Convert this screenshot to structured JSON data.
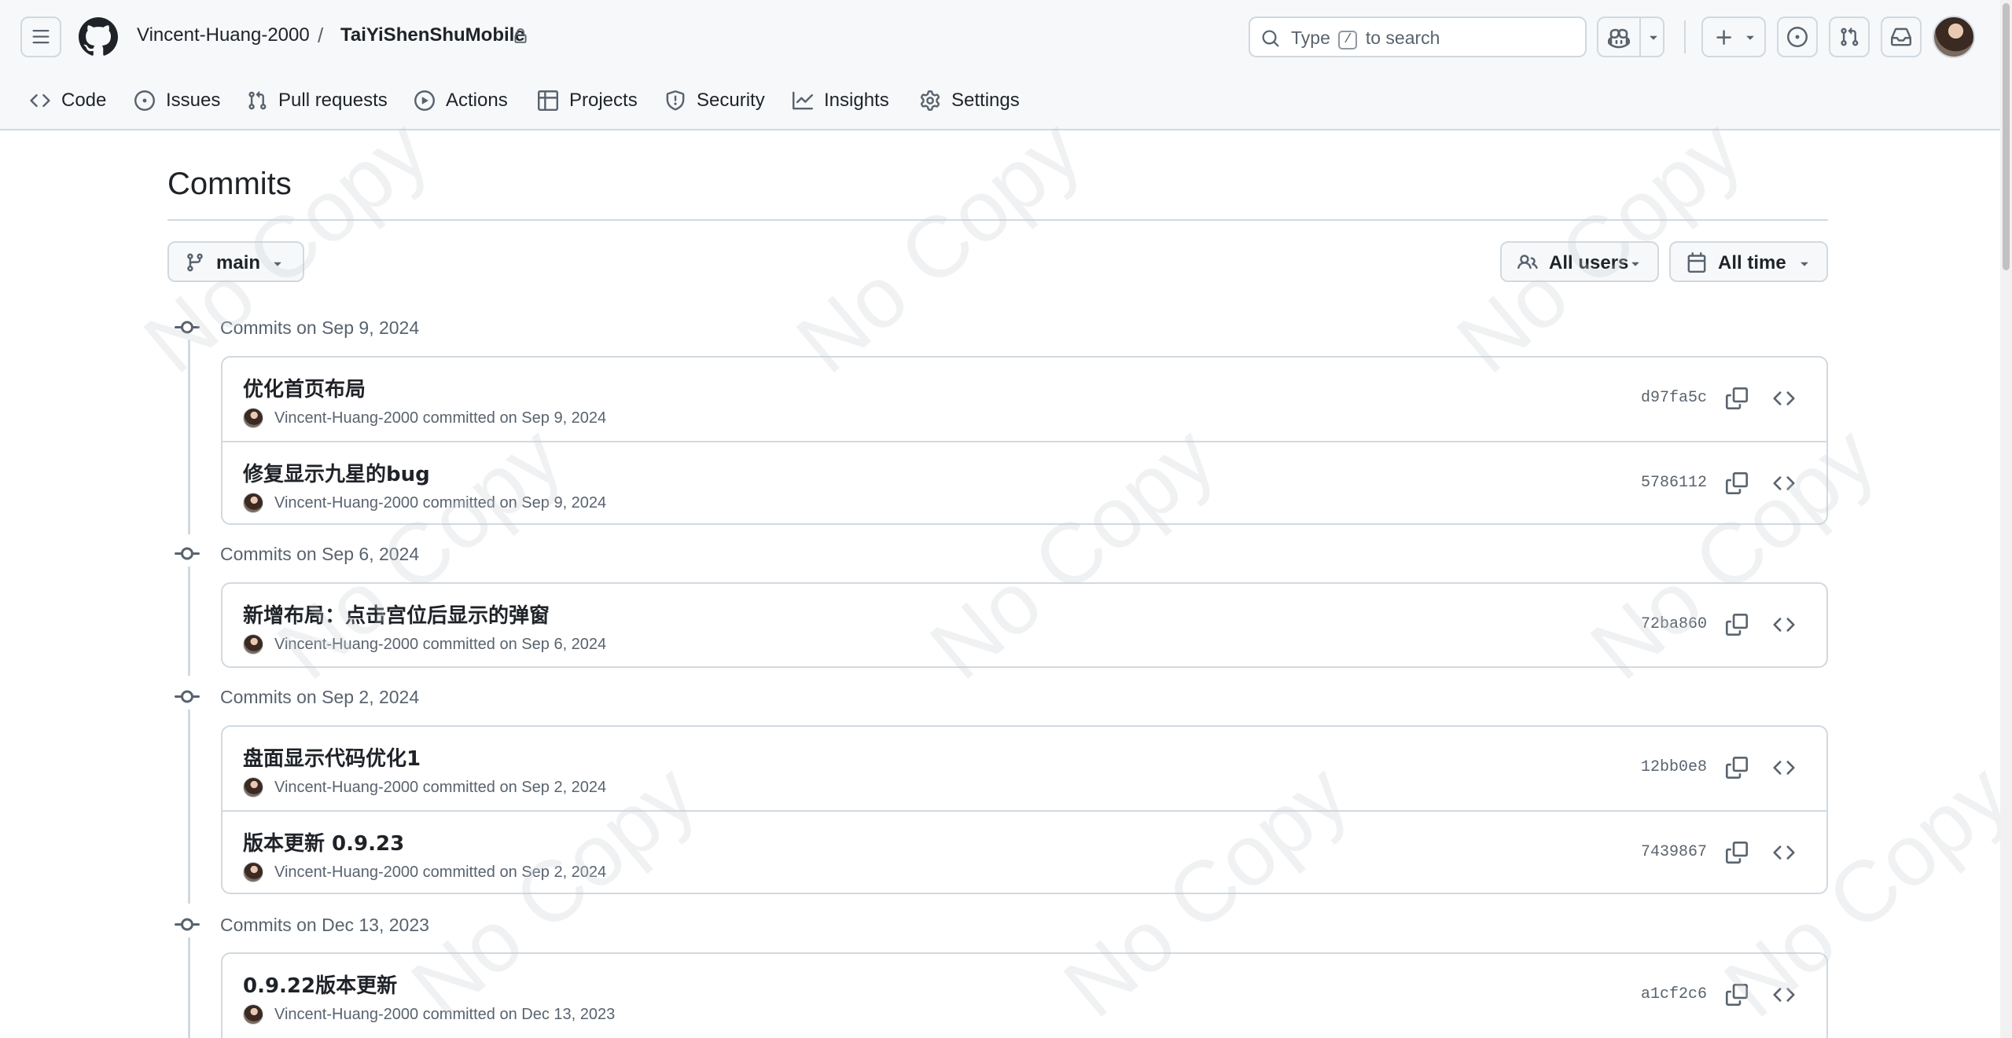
{
  "header": {
    "owner": "Vincent-Huang-2000",
    "separator": "/",
    "repo": "TaiYiShenShuMobile",
    "search": {
      "prefix": "Type",
      "key": "/",
      "suffix": "to search"
    }
  },
  "nav": {
    "tabs": [
      {
        "label": "Code",
        "icon": "code-icon"
      },
      {
        "label": "Issues",
        "icon": "issue-icon"
      },
      {
        "label": "Pull requests",
        "icon": "pull-request-icon"
      },
      {
        "label": "Actions",
        "icon": "play-icon"
      },
      {
        "label": "Projects",
        "icon": "table-icon"
      },
      {
        "label": "Security",
        "icon": "shield-icon"
      },
      {
        "label": "Insights",
        "icon": "graph-icon"
      },
      {
        "label": "Settings",
        "icon": "gear-icon"
      }
    ]
  },
  "page": {
    "title": "Commits",
    "branch": "main",
    "users_filter": "All users",
    "time_filter": "All time"
  },
  "groups": [
    {
      "title": "Commits on Sep 9, 2024",
      "commits": [
        {
          "message": "优化首页布局",
          "author": "Vincent-Huang-2000",
          "verb": "committed on",
          "date": "Sep 9, 2024",
          "sha": "d97fa5c"
        },
        {
          "message": "修复显示九星的bug",
          "author": "Vincent-Huang-2000",
          "verb": "committed on",
          "date": "Sep 9, 2024",
          "sha": "5786112"
        }
      ]
    },
    {
      "title": "Commits on Sep 6, 2024",
      "commits": [
        {
          "message": "新增布局：点击宫位后显示的弹窗",
          "author": "Vincent-Huang-2000",
          "verb": "committed on",
          "date": "Sep 6, 2024",
          "sha": "72ba860"
        }
      ]
    },
    {
      "title": "Commits on Sep 2, 2024",
      "commits": [
        {
          "message": "盘面显示代码优化1",
          "author": "Vincent-Huang-2000",
          "verb": "committed on",
          "date": "Sep 2, 2024",
          "sha": "12bb0e8"
        },
        {
          "message": "版本更新 0.9.23",
          "author": "Vincent-Huang-2000",
          "verb": "committed on",
          "date": "Sep 2, 2024",
          "sha": "7439867"
        }
      ]
    },
    {
      "title": "Commits on Dec 13, 2023",
      "commits": [
        {
          "message": "0.9.22版本更新",
          "author": "Vincent-Huang-2000",
          "verb": "committed on",
          "date": "Dec 13, 2023",
          "sha": "a1cf2c6"
        }
      ]
    }
  ],
  "watermark": "No Copy",
  "colors": {
    "header_bg": "#f6f8fa",
    "border": "#d1d9e0",
    "text": "#1f2328",
    "muted": "#59636e"
  }
}
